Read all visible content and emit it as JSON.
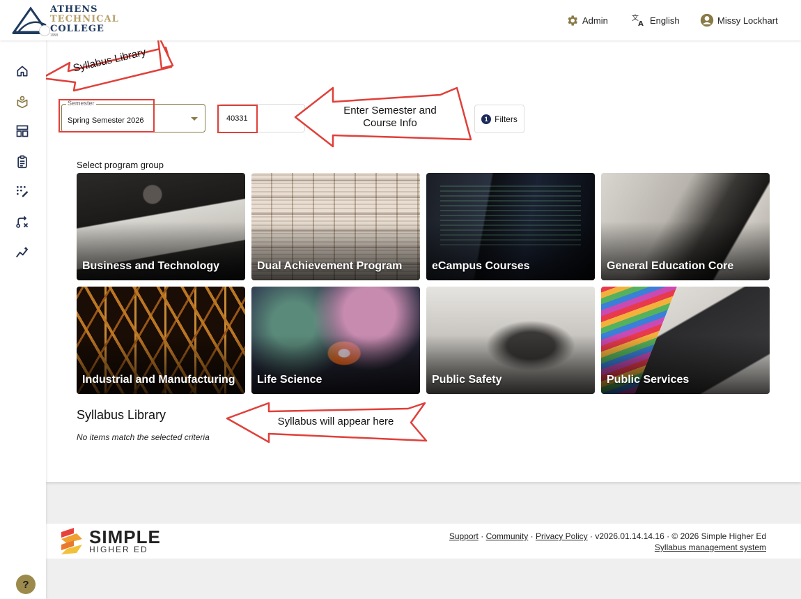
{
  "header": {
    "logo": {
      "line1": "ATHENS",
      "line2": "TECHNICAL",
      "line3": "COLLEGE",
      "line4": "1958"
    },
    "admin_label": "Admin",
    "language_label": "English",
    "user_name": "Missy Lockhart"
  },
  "sidebar": {
    "items": [
      {
        "icon": "home-icon"
      },
      {
        "icon": "syllabus-library-icon",
        "active": true
      },
      {
        "icon": "dashboard-icon"
      },
      {
        "icon": "clipboard-icon"
      },
      {
        "icon": "edit-grid-icon"
      },
      {
        "icon": "workflow-icon"
      },
      {
        "icon": "analytics-icon"
      }
    ],
    "help_label": "?"
  },
  "filters": {
    "semester_label": "Semester",
    "semester_value": "Spring Semester 2026",
    "course_value": "40331",
    "filters_label": "Filters",
    "filters_count": "1"
  },
  "program_groups": {
    "heading": "Select program group",
    "tiles": [
      {
        "name": "Business and Technology"
      },
      {
        "name": "Dual Achievement Program"
      },
      {
        "name": "eCampus Courses"
      },
      {
        "name": "General Education Core"
      },
      {
        "name": "Industrial and Manufacturing"
      },
      {
        "name": "Life Science"
      },
      {
        "name": "Public Safety"
      },
      {
        "name": "Public Services"
      }
    ]
  },
  "library": {
    "title": "Syllabus Library",
    "empty_message": "No items match the selected criteria"
  },
  "annotations": {
    "callout_library": "Syllabus Library",
    "callout_enter_line1": "Enter Semester and",
    "callout_enter_line2": "Course Info",
    "callout_appear": "Syllabus will appear here"
  },
  "footer": {
    "logo_line1": "SIMPLE",
    "logo_line2": "HIGHER ED",
    "support": "Support",
    "community": "Community",
    "privacy": "Privacy Policy",
    "version": "v2026.01.14.14.16 · © 2026 Simple Higher Ed",
    "system_link": "Syllabus management system"
  },
  "colors": {
    "accent_gold": "#8a7a46",
    "brand_navy": "#1f3a5f",
    "annotation_red": "#e0403a"
  }
}
